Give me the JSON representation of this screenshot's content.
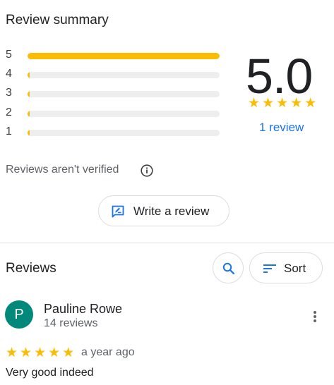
{
  "summary": {
    "title": "Review summary",
    "distribution": [
      {
        "stars": "5",
        "fraction": 1.0
      },
      {
        "stars": "4",
        "fraction": 0.0
      },
      {
        "stars": "3",
        "fraction": 0.0
      },
      {
        "stars": "2",
        "fraction": 0.0
      },
      {
        "stars": "1",
        "fraction": 0.0
      }
    ],
    "rating": "5.0",
    "rating_stars": "★★★★★",
    "review_count_link": "1 review",
    "not_verified": "Reviews aren't verified",
    "write_review_label": "Write a review"
  },
  "reviews": {
    "title": "Reviews",
    "sort_label": "Sort",
    "items": [
      {
        "avatar_letter": "P",
        "avatar_color": "#00897b",
        "author": "Pauline Rowe",
        "author_meta": "14 reviews",
        "stars": "★★★★★",
        "time": "a year ago",
        "text": "Very good indeed"
      }
    ]
  },
  "colors": {
    "star": "#fbbc04",
    "link": "#1a73e8",
    "accent_icon": "#1a73e8"
  },
  "icons": {
    "info": "info-icon",
    "write": "rate-review-icon",
    "search": "search-icon",
    "sort": "sort-icon",
    "more": "more-vert-icon"
  }
}
